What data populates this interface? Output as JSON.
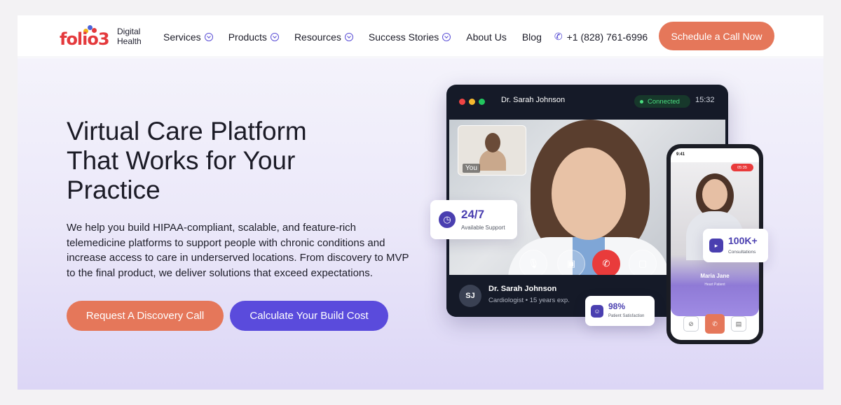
{
  "header": {
    "logo_word": "folio3",
    "logo_sub_line1": "Digital",
    "logo_sub_line2": "Health",
    "nav": [
      {
        "label": "Services",
        "has_dropdown": true
      },
      {
        "label": "Products",
        "has_dropdown": true
      },
      {
        "label": "Resources",
        "has_dropdown": true
      },
      {
        "label": "Success Stories",
        "has_dropdown": true
      },
      {
        "label": "About Us",
        "has_dropdown": false
      },
      {
        "label": "Blog",
        "has_dropdown": false
      }
    ],
    "phone": "+1 (828) 761-6996",
    "phone_icon": "phone-icon",
    "cta": "Schedule a Call Now"
  },
  "hero": {
    "title_line1": "Virtual Care Platform",
    "title_line2": "That Works for Your",
    "title_line3": "Practice",
    "description": "We help you build HIPAA-compliant, scalable, and feature-rich telemedicine platforms to support people with chronic conditions and increase access to care in underserved locations. From discovery to MVP to the final product, we deliver solutions that exceed expectations.",
    "primary_button": "Request A Discovery Call",
    "secondary_button": "Calculate Your Build Cost"
  },
  "call_window": {
    "doctor_name": "Dr. Sarah Johnson",
    "status": "Connected",
    "timer": "15:32",
    "self_label": "You",
    "initials": "SJ",
    "footer_name": "Dr. Sarah Johnson",
    "footer_role": "Cardiologist • 15 years exp."
  },
  "cards": {
    "support_value": "24/7",
    "support_label": "Available Support",
    "consult_value": "100K+",
    "consult_label": "Consultations",
    "satisfaction_value": "98%",
    "satisfaction_label": "Patient Satisfaction"
  },
  "mobile": {
    "time": "9:41",
    "rec_time": "05:35",
    "patient_name": "Maria Jane",
    "patient_role": "Heart Patient"
  },
  "colors": {
    "accent_orange": "#e5775a",
    "accent_purple": "#5a4bdc",
    "logo_red": "#e4393c"
  }
}
